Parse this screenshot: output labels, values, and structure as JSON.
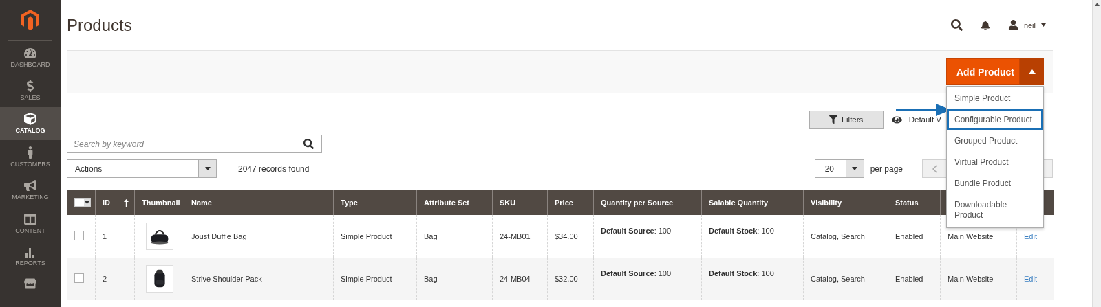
{
  "sidebar": {
    "items": [
      {
        "label": "DASHBOARD",
        "selected": false
      },
      {
        "label": "SALES",
        "selected": false
      },
      {
        "label": "CATALOG",
        "selected": true
      },
      {
        "label": "CUSTOMERS",
        "selected": false
      },
      {
        "label": "MARKETING",
        "selected": false
      },
      {
        "label": "CONTENT",
        "selected": false
      },
      {
        "label": "REPORTS",
        "selected": false
      }
    ]
  },
  "header": {
    "title": "Products",
    "user": "neil"
  },
  "toolbar": {
    "add_button": "Add Product",
    "menu": [
      {
        "label": "Simple Product",
        "selected": false
      },
      {
        "label": "Configurable Product",
        "selected": true
      },
      {
        "label": "Grouped Product",
        "selected": false
      },
      {
        "label": "Virtual Product",
        "selected": false
      },
      {
        "label": "Bundle Product",
        "selected": false
      },
      {
        "label": "Downloadable Product",
        "selected": false
      }
    ]
  },
  "grid": {
    "filters_button": "Filters",
    "view_label": "Default V",
    "search": {
      "placeholder": "Search by keyword"
    },
    "actions": "Actions",
    "records": "2047 records found",
    "per_page_value": "20",
    "per_page_label": "per page"
  },
  "table": {
    "mass_select": {
      "checked": false
    },
    "columns": [
      {
        "label": "ID",
        "sorted": true
      },
      {
        "label": "Thumbnail",
        "sorted": false
      },
      {
        "label": "Name",
        "sorted": false
      },
      {
        "label": "Type",
        "sorted": false
      },
      {
        "label": "Attribute Set",
        "sorted": false
      },
      {
        "label": "SKU",
        "sorted": false
      },
      {
        "label": "Price",
        "sorted": false
      },
      {
        "label": "Quantity per Source",
        "sorted": false
      },
      {
        "label": "Salable Quantity",
        "sorted": false
      },
      {
        "label": "Visibility",
        "sorted": false
      },
      {
        "label": "Status",
        "sorted": false
      }
    ],
    "rows": [
      {
        "checked": false,
        "id": "1",
        "name": "Joust Duffle Bag",
        "type": "Simple Product",
        "attribute_set": "Bag",
        "sku": "24-MB01",
        "price": "$34.00",
        "quantity_per_source": "**Default Source**: 100",
        "salable_quantity": "**Default Stock**: 100",
        "visibility": "Catalog, Search",
        "status": "Enabled",
        "column_11": "Main Website",
        "action": "Edit"
      },
      {
        "checked": false,
        "id": "2",
        "name": "Strive Shoulder Pack",
        "type": "Simple Product",
        "attribute_set": "Bag",
        "sku": "24-MB04",
        "price": "$32.00",
        "quantity_per_source": "**Default Source**: 100",
        "salable_quantity": "**Default Stock**: 100",
        "visibility": "Catalog, Search",
        "status": "Enabled",
        "column_11": "Main Website",
        "action": "Edit"
      }
    ]
  }
}
